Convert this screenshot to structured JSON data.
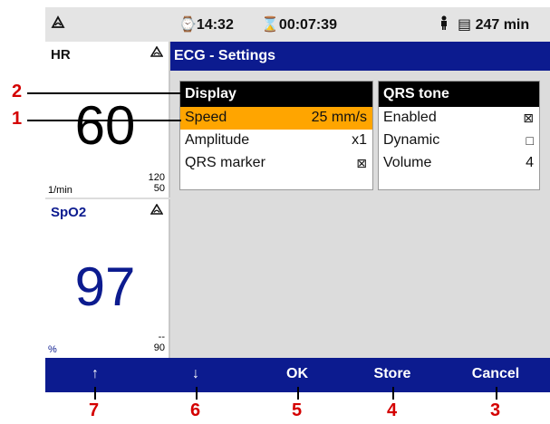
{
  "statusbar": {
    "alarm_icon": "bell-off-icon",
    "time": "⌚14:32",
    "timer": "⌛00:07:39",
    "patient_icon": "person-icon",
    "battery": "▤ 247 min"
  },
  "hr": {
    "label": "HR",
    "value": "60",
    "unit": "1/min",
    "upper_limit": "120",
    "lower_limit": "50"
  },
  "spo2": {
    "label": "SpO2",
    "value": "97",
    "unit": "%",
    "upper_limit": "--",
    "lower_limit": "90"
  },
  "settings": {
    "title": "ECG - Settings"
  },
  "display_table": {
    "header": "Display",
    "rows": [
      {
        "label": "Speed",
        "value": "25 mm/s"
      },
      {
        "label": "Amplitude",
        "value": "x1"
      },
      {
        "label": "QRS marker",
        "value": "⊠"
      }
    ]
  },
  "qrs_table": {
    "header": "QRS tone",
    "rows": [
      {
        "label": "Enabled",
        "value": "⊠"
      },
      {
        "label": "Dynamic",
        "value": "□"
      },
      {
        "label": "Volume",
        "value": "4"
      }
    ]
  },
  "softkeys": {
    "up": "↑",
    "down": "↓",
    "ok": "OK",
    "store": "Store",
    "cancel": "Cancel"
  },
  "callouts": [
    "1",
    "2",
    "3",
    "4",
    "5",
    "6",
    "7"
  ],
  "colors": {
    "accent_blue": "#0c1b8f",
    "highlight": "#ffa500",
    "callout_red": "#d40000"
  }
}
